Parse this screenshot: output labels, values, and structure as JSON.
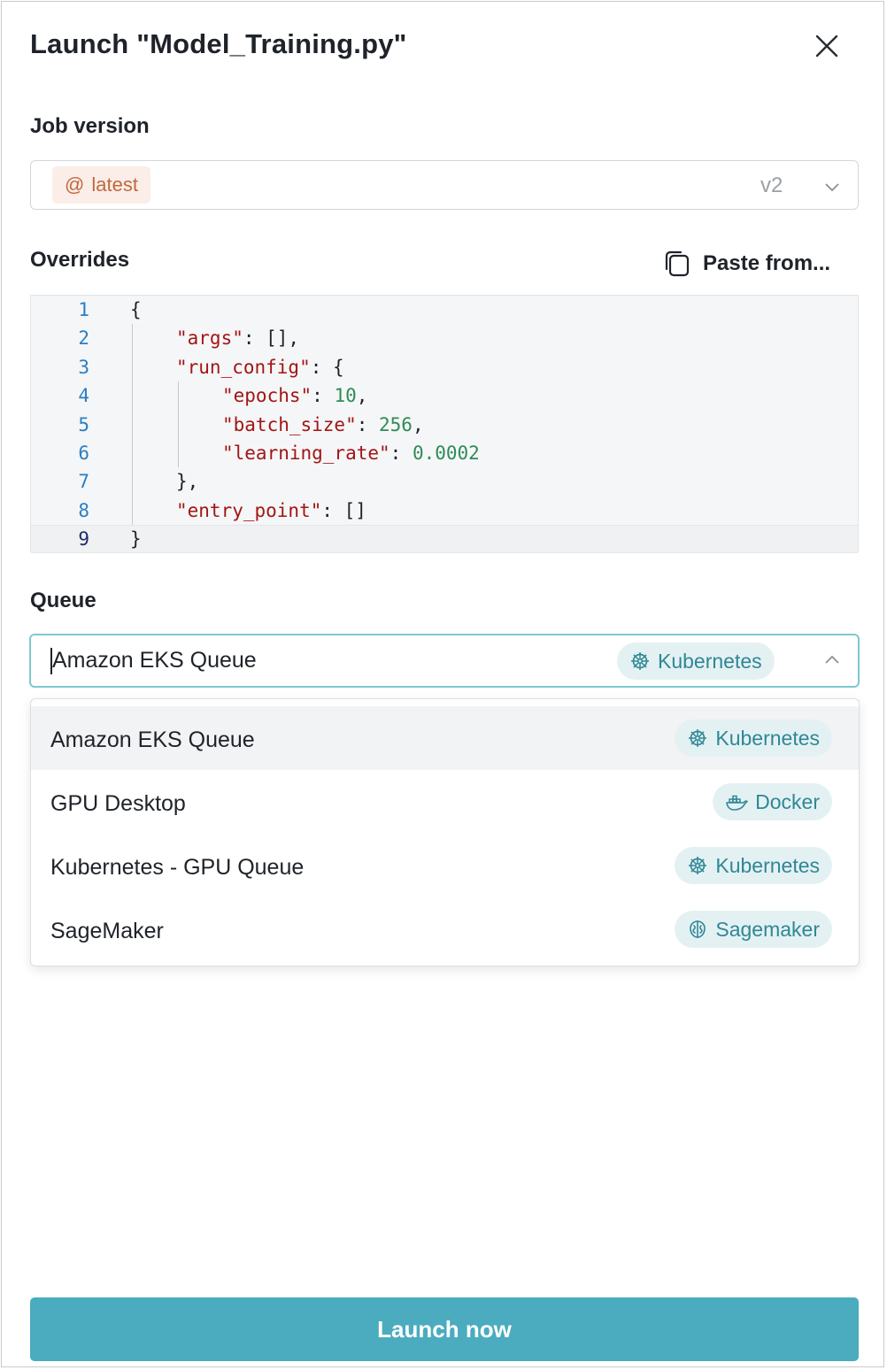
{
  "dialog": {
    "title": "Launch \"Model_Training.py\""
  },
  "job_version": {
    "label": "Job version",
    "tag": "latest",
    "version": "v2"
  },
  "overrides": {
    "label": "Overrides",
    "paste_label": "Paste from..."
  },
  "editor": {
    "line_numbers": [
      "1",
      "2",
      "3",
      "4",
      "5",
      "6",
      "7",
      "8",
      "9"
    ],
    "active_line": 9,
    "lines": [
      [
        {
          "t": "p",
          "v": "{"
        }
      ],
      [
        {
          "t": "k",
          "v": "\"args\""
        },
        {
          "t": "p",
          "v": ": [],"
        }
      ],
      [
        {
          "t": "k",
          "v": "\"run_config\""
        },
        {
          "t": "p",
          "v": ": {"
        }
      ],
      [
        {
          "t": "k",
          "v": "\"epochs\""
        },
        {
          "t": "p",
          "v": ": "
        },
        {
          "t": "n",
          "v": "10"
        },
        {
          "t": "p",
          "v": ","
        }
      ],
      [
        {
          "t": "k",
          "v": "\"batch_size\""
        },
        {
          "t": "p",
          "v": ": "
        },
        {
          "t": "n",
          "v": "256"
        },
        {
          "t": "p",
          "v": ","
        }
      ],
      [
        {
          "t": "k",
          "v": "\"learning_rate\""
        },
        {
          "t": "p",
          "v": ": "
        },
        {
          "t": "n",
          "v": "0.0002"
        }
      ],
      [
        {
          "t": "p",
          "v": "},"
        }
      ],
      [
        {
          "t": "k",
          "v": "\"entry_point\""
        },
        {
          "t": "p",
          "v": ": []"
        }
      ],
      [
        {
          "t": "p",
          "v": "}"
        }
      ]
    ],
    "indent_levels": [
      0,
      1,
      1,
      2,
      2,
      2,
      1,
      1,
      0
    ]
  },
  "queue": {
    "label": "Queue",
    "selected": "Amazon EKS Queue",
    "selected_type": "Kubernetes",
    "options": [
      {
        "label": "Amazon EKS Queue",
        "type": "Kubernetes",
        "icon": "kubernetes-icon"
      },
      {
        "label": "GPU Desktop",
        "type": "Docker",
        "icon": "docker-icon"
      },
      {
        "label": "Kubernetes - GPU Queue",
        "type": "Kubernetes",
        "icon": "kubernetes-icon"
      },
      {
        "label": "SageMaker",
        "type": "Sagemaker",
        "icon": "sagemaker-icon"
      }
    ]
  },
  "launch_button": "Launch now",
  "colors": {
    "accent": "#4aacbe",
    "tag_bg": "#fbede7",
    "tag_fg": "#c0683f",
    "pill_bg": "#e4f1f3",
    "pill_fg": "#2f8795",
    "json_key": "#a31515",
    "json_number": "#2e8b57",
    "line_number": "#2b7ec2"
  }
}
